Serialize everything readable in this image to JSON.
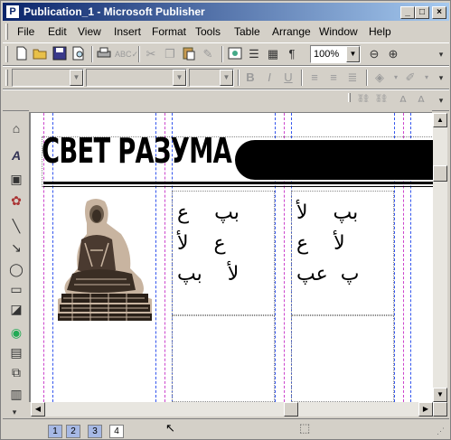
{
  "window": {
    "title": "Publication_1 - Microsoft Publisher",
    "app_icon_letter": "P",
    "controls": {
      "minimize": "_",
      "maximize": "□",
      "close": "×"
    }
  },
  "menu": [
    "File",
    "Edit",
    "View",
    "Insert",
    "Format",
    "Tools",
    "Table",
    "Arrange",
    "Window",
    "Help"
  ],
  "toolbar": {
    "zoom_value": "100%",
    "icons": [
      "new-icon",
      "open-icon",
      "save-icon",
      "print-preview-icon",
      "print-icon",
      "spelling-icon",
      "cut-icon",
      "copy-icon",
      "paste-icon",
      "format-painter-icon",
      "columns-icon",
      "insert-table-icon",
      "show-formatting-icon",
      "zoom-out-icon",
      "zoom-in-icon"
    ]
  },
  "formatting": {
    "style_value": "",
    "font_value": "",
    "size_value": "",
    "bold": "B",
    "italic": "I",
    "underline": "U"
  },
  "document": {
    "heading": "СВЕТ РАЗУМА",
    "column2_lines": [
      "ب‍پ    ع",
      "ع    لأ",
      "لأ    ب‍پ"
    ],
    "column3_lines": [
      "ب‍پ    لأ",
      "لأ    ع",
      "پ  ع‍پ"
    ]
  },
  "pages": [
    "1",
    "2",
    "3",
    "4"
  ],
  "active_page": "4"
}
